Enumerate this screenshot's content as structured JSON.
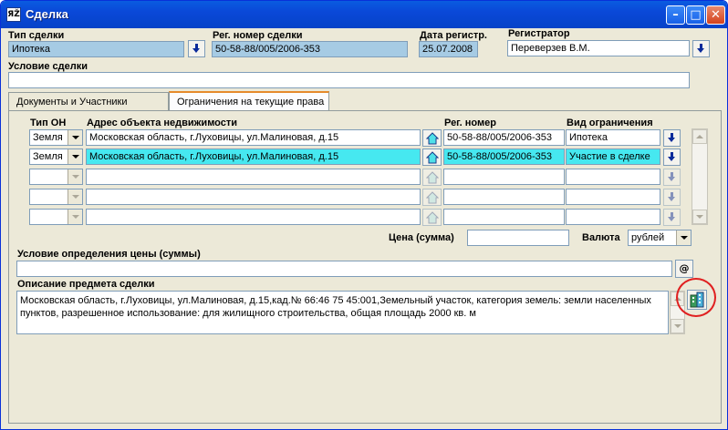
{
  "window": {
    "title": "Сделка",
    "app_icon_text": "ЯŽ"
  },
  "header": {
    "deal_type_label": "Тип сделки",
    "deal_type_value": "Ипотека",
    "reg_number_label": "Рег. номер сделки",
    "reg_number_value": "50-58-88/005/2006-353",
    "reg_date_label": "Дата регистр.",
    "reg_date_value": "25.07.2008",
    "registrar_label": "Регистратор",
    "registrar_value": "Переверзев В.М.",
    "condition_label": "Условие сделки",
    "condition_value": ""
  },
  "tabs": [
    {
      "label": "Документы и Участники",
      "active": false
    },
    {
      "label": "Ограничения на текущие права",
      "active": true
    }
  ],
  "grid": {
    "col_type": "Тип ОН",
    "col_address": "Адрес объекта недвижимости",
    "col_reg": "Рег. номер",
    "col_restriction": "Вид ограничения",
    "rows": [
      {
        "type": "Земля",
        "address": "Московская область, г.Луховицы, ул.Малиновая, д.15",
        "reg": "50-58-88/005/2006-353",
        "restriction": "Ипотека",
        "selected": false
      },
      {
        "type": "Земля",
        "address": "Московская область, г.Луховицы, ул.Малиновая, д.15",
        "reg": "50-58-88/005/2006-353",
        "restriction": "Участие в сделке",
        "selected": true
      },
      {
        "type": "",
        "address": "",
        "reg": "",
        "restriction": "",
        "selected": false
      },
      {
        "type": "",
        "address": "",
        "reg": "",
        "restriction": "",
        "selected": false
      },
      {
        "type": "",
        "address": "",
        "reg": "",
        "restriction": "",
        "selected": false
      }
    ]
  },
  "price": {
    "label": "Цена (сумма)",
    "value": "",
    "currency_label": "Валюта",
    "currency_value": "рублей"
  },
  "price_condition": {
    "label": "Условие определения цены (суммы)",
    "value": "",
    "at_button": "@"
  },
  "subject": {
    "label": "Описание предмета сделки",
    "value": "Московская область, г.Луховицы, ул.Малиновая, д.15,кад.№ 66:46 75 45:001,Земельный участок, категория земель: земли населенных пунктов, разрешенное использование: для жилищного строительства, общая площадь 2000 кв. м"
  },
  "colors": {
    "selected_row": "#46e8f0",
    "readonly_field": "#a6cbe4",
    "title_bar": "#0a48d8",
    "highlight_ring": "#e02020"
  }
}
